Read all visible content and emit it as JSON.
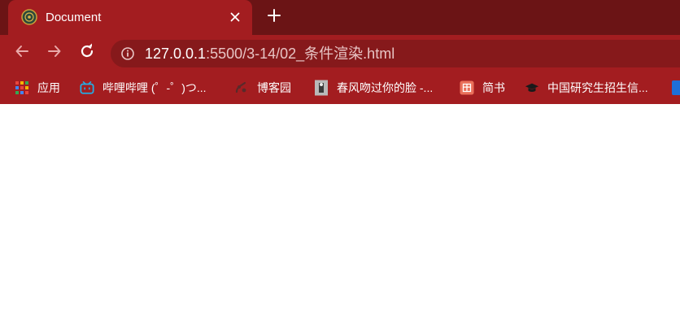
{
  "tab": {
    "title": "Document",
    "favicon": "globe-emblem-icon",
    "close_icon": "close-icon"
  },
  "new_tab_icon": "plus-icon",
  "toolbar": {
    "back_icon": "arrow-left-icon",
    "forward_icon": "arrow-right-icon",
    "reload_icon": "reload-icon",
    "info_icon": "info-circle-icon",
    "url_host": "127.0.0.1",
    "url_path": ":5500/3-14/02_条件渲染.html"
  },
  "bookmarks": [
    {
      "label": "应用",
      "icon": "apps-grid-icon"
    },
    {
      "label": "哔哩哔哩 (゜-゜)つ...",
      "icon": "bilibili-tv-icon"
    },
    {
      "label": "博客园",
      "icon": "cnblogs-icon"
    },
    {
      "label": "春风吻过你的脸 -...",
      "icon": "image-thumbnail-icon"
    },
    {
      "label": "简书",
      "icon": "jianshu-icon"
    },
    {
      "label": "中国研究生招生信...",
      "icon": "graduation-cap-icon"
    }
  ],
  "colors": {
    "tabstrip": "#6b1415",
    "active_tab": "#a31d20",
    "omnibox": "#86191b",
    "page": "#ffffff"
  }
}
